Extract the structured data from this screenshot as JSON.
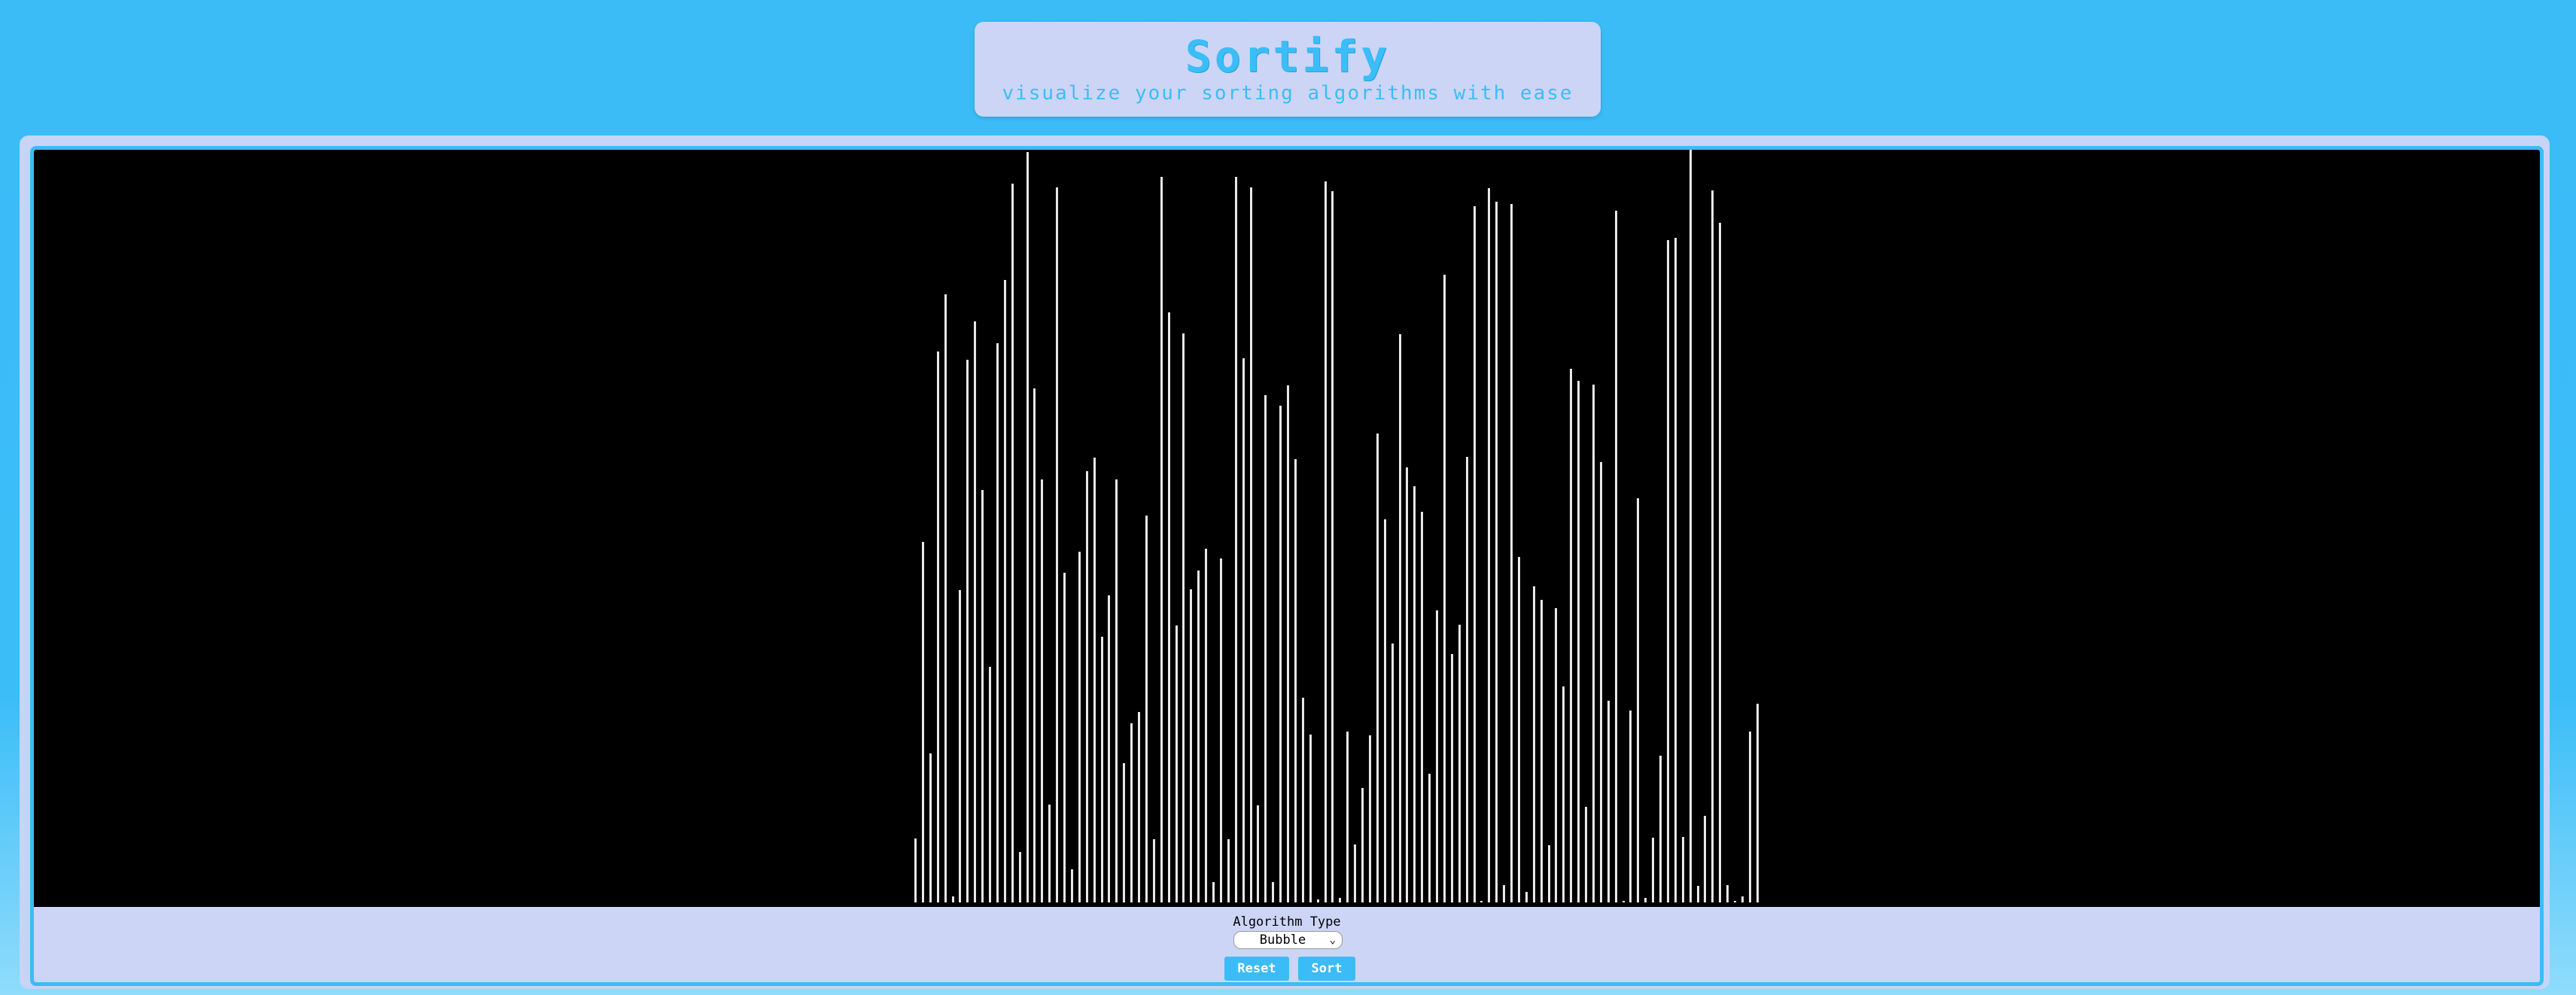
{
  "header": {
    "title": "Sortify",
    "subtitle": "visualize your sorting algorithms with ease"
  },
  "controls": {
    "algorithm_label": "Algorithm Type",
    "algorithm_selected": "Bubble",
    "reset_label": "Reset",
    "sort_label": "Sort"
  },
  "colors": {
    "background": "#3bbcf7",
    "panel": "#ccd5f5",
    "canvas": "#000000",
    "bar": "#e8e8e8",
    "accent": "#3bbcf7"
  },
  "icons": {
    "select_chevron": "chevron-down-icon"
  },
  "array": {
    "max_value": 1000,
    "values": [
      85,
      479,
      198,
      732,
      808,
      8,
      415,
      721,
      772,
      548,
      313,
      743,
      827,
      955,
      67,
      997,
      683,
      562,
      130,
      950,
      438,
      44,
      466,
      573,
      591,
      353,
      408,
      562,
      185,
      238,
      253,
      514,
      84,
      964,
      784,
      368,
      756,
      416,
      441,
      470,
      27,
      457,
      84,
      964,
      723,
      950,
      129,
      674,
      27,
      660,
      687,
      589,
      272,
      223,
      4,
      958,
      945,
      6,
      227,
      77,
      152,
      222,
      623,
      509,
      344,
      755,
      578,
      553,
      519,
      171,
      388,
      834,
      330,
      369,
      592,
      925,
      0,
      949,
      931,
      23,
      928,
      459,
      14,
      420,
      402,
      76,
      391,
      287,
      709,
      693,
      127,
      688,
      585,
      268,
      919,
      0,
      255,
      537,
      6,
      86,
      195,
      880,
      883,
      87,
      1000,
      22,
      115,
      946,
      903,
      23,
      0,
      8,
      227,
      264
    ]
  }
}
